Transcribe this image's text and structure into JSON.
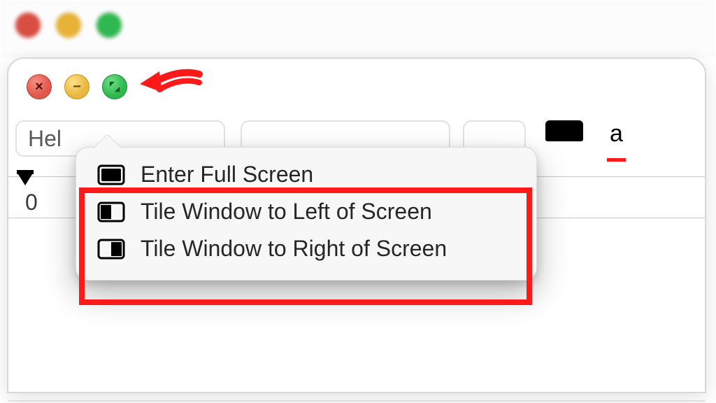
{
  "toolbar": {
    "font_fragment": "Hel",
    "ruler_first_tick": "0"
  },
  "menu": {
    "items": [
      {
        "label": "Enter Full Screen",
        "kind": "full"
      },
      {
        "label": "Tile Window to Left of Screen",
        "kind": "left"
      },
      {
        "label": "Tile Window to Right of Screen",
        "kind": "right"
      }
    ]
  },
  "colors": {
    "close": "#e0584d",
    "minimize": "#e8b73e",
    "zoom": "#2fb84f",
    "annotation": "#ff1a1a"
  }
}
